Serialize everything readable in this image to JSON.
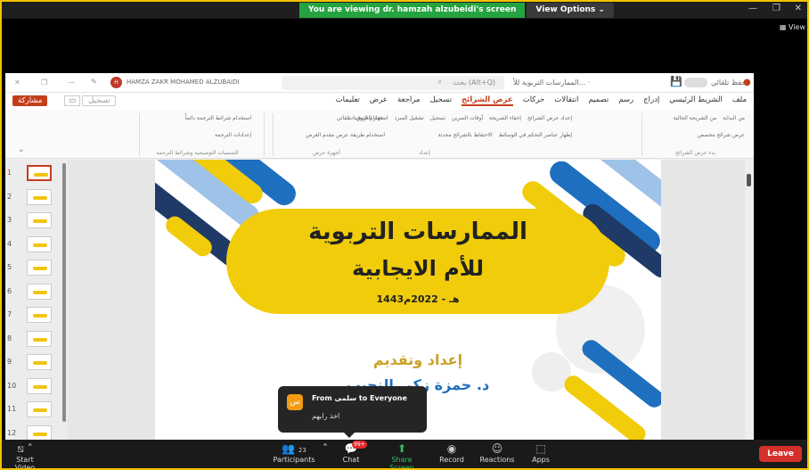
{
  "zoom": {
    "share_banner": "You are viewing dr. hamzah alzubeidi's screen",
    "view_options": "View Options ⌄",
    "view_label": "▦ View",
    "toolbar": {
      "start_video": "Start Video",
      "participants": "Participants",
      "participants_count": "23",
      "chat": "Chat",
      "chat_badge": "99+",
      "share_screen": "Share Screen",
      "record": "Record",
      "reactions": "Reactions",
      "apps": "Apps",
      "leave": "Leave"
    },
    "chat_toast": {
      "avatar": "س",
      "from": "From سلمى to Everyone",
      "message": "اخذ رايهم"
    }
  },
  "ppt": {
    "user_name": "HAMZA ZAKR MOHAMED ALZUBAIDI",
    "search_placeholder": "بحث (Alt+Q)",
    "doc_title": "الممارسات التربوية للأ... ·",
    "autosave": "حفظ تلقائي",
    "share_button": "مشاركة",
    "record_button": "تسجيل",
    "tabs": [
      "ملف",
      "الشريط الرئيسي",
      "إدراج",
      "رسم",
      "تصميم",
      "انتقالات",
      "حركات",
      "عرض الشرائح",
      "تسجيل",
      "مراجعة",
      "عرض",
      "تعليمات"
    ],
    "active_tab": "عرض الشرائح",
    "ribbon_groups": [
      {
        "label": "بدء عرض الشرائح",
        "items": [
          "من البداية",
          "من الشريحة الحالية",
          "عرض شرائح مخصص"
        ]
      },
      {
        "label": "إعداد",
        "items": [
          "إعداد عرض الشرائح",
          "إخفاء الشريحة",
          "أوقات التمرين",
          "تسجيل",
          "تشغيل السرد",
          "استخدام التوقيتات",
          "إظهار عناصر التحكم في الوسائط",
          "الاحتفاظ بالشرائح محدثة"
        ]
      },
      {
        "label": "أجهزة عرض",
        "items": [
          "جهاز العرض:",
          "تلقائي",
          "استخدام طريقة عرض مقدم العرض"
        ]
      },
      {
        "label": "التسميات التوضيحية وشرائط الترجمة",
        "items": [
          "استخدام شرائط الترجمة دائماً",
          "إعدادات الترجمة"
        ]
      }
    ],
    "slide_numbers": [
      "1",
      "2",
      "3",
      "4",
      "5",
      "6",
      "7",
      "8",
      "9",
      "10",
      "11",
      "12"
    ],
    "selected_slide": "1",
    "slide": {
      "title_line1": "الممارسات التربوية",
      "title_line2": "للأم الايجابية",
      "date": "1443هـ - 2022م",
      "prepared_by": "إعداد وتقديم",
      "presenter": "د. حمزة زكي النجيب",
      "colors": {
        "yellow": "#f1cc0a",
        "blue": "#1e6fbf",
        "navy": "#1f3a66",
        "light_blue": "#9fc2e8",
        "gold_text": "#c9a227"
      }
    }
  }
}
